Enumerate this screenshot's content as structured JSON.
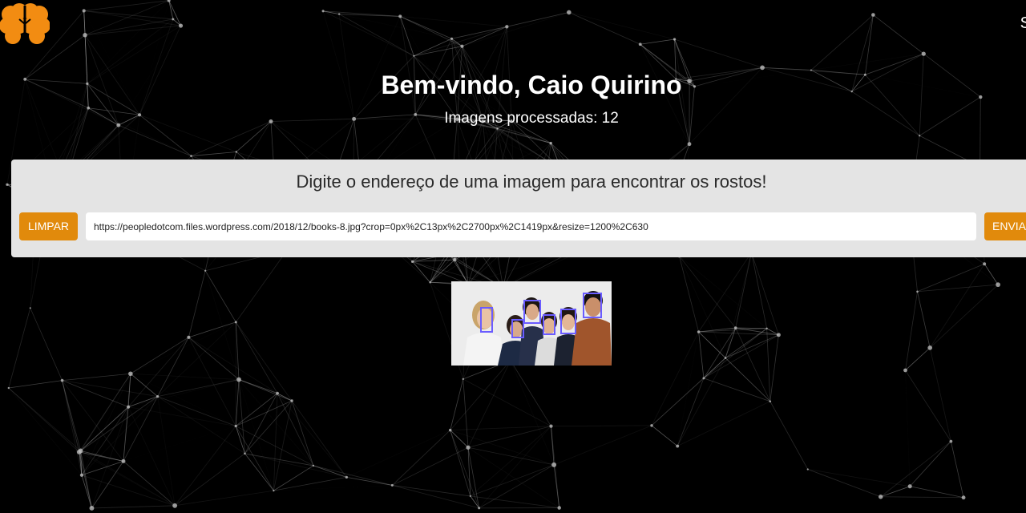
{
  "header": {
    "logo_icon": "brain-icon",
    "logo_color": "#F28C12",
    "nav_link": "S"
  },
  "welcome": {
    "title": "Bem-vindo, Caio Quirino",
    "counter": "Imagens processadas: 12"
  },
  "form": {
    "prompt": "Digite o endereço de uma imagem para encontrar os rostos!",
    "clear_label": "LIMPAR",
    "send_label": "ENVIAR",
    "url_value": "https://peopledotcom.files.wordpress.com/2018/12/books-8.jpg?crop=0px%2C13px%2C2700px%2C1419px&resize=1200%2C630",
    "accent_color": "#E18A0C"
  },
  "result": {
    "detected_faces": 6,
    "face_box_color": "#6A5CFF"
  }
}
